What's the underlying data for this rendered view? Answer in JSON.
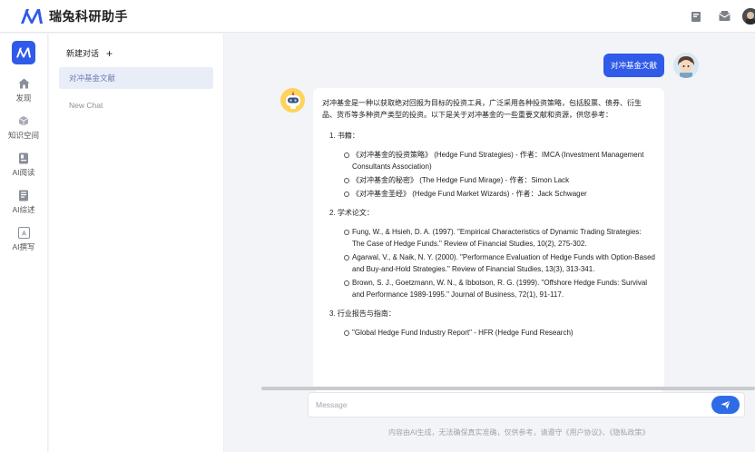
{
  "header": {
    "title": "瑞兔科研助手"
  },
  "nav": {
    "items": [
      {
        "label": "发现",
        "icon": "home-icon"
      },
      {
        "label": "知识空间",
        "icon": "cube-icon"
      },
      {
        "label": "AI阅读",
        "icon": "document-icon"
      },
      {
        "label": "AI综述",
        "icon": "report-icon"
      },
      {
        "label": "AI撰写",
        "icon": "write-icon"
      }
    ]
  },
  "sidebar": {
    "new_chat_label": "新建对话",
    "new_chat_plus": "+",
    "conversations": [
      {
        "label": "对冲基金文献",
        "active": true
      },
      {
        "label": "New Chat",
        "active": false
      }
    ]
  },
  "chat": {
    "user_message": "对冲基金文献",
    "bot": {
      "intro": "对冲基金是一种以获取绝对回报为目标的投资工具，广泛采用各种投资策略，包括股票、债券、衍生品、货币等多种资产类型的投资。以下是关于对冲基金的一些重要文献和资源，供您参考：",
      "sections": [
        {
          "title": "1. 书籍：",
          "items": [
            "《对冲基金的投资策略》 (Hedge Fund Strategies) - 作者：IMCA (Investment Management Consultants Association)",
            "《对冲基金的秘密》 (The Hedge Fund Mirage) - 作者：Simon Lack",
            "《对冲基金圣经》 (Hedge Fund Market Wizards) - 作者：Jack Schwager"
          ]
        },
        {
          "title": "2. 学术论文：",
          "items": [
            "Fung, W., & Hsieh, D. A. (1997). \"Empirical Characteristics of Dynamic Trading Strategies: The Case of Hedge Funds.\" Review of Financial Studies, 10(2), 275-302.",
            "Agarwal, V., & Naik, N. Y. (2000). \"Performance Evaluation of Hedge Funds with Option-Based and Buy-and-Hold Strategies.\" Review of Financial Studies, 13(3), 313-341.",
            "Brown, S. J., Goetzmann, W. N., & Ibbotson, R. G. (1999). \"Offshore Hedge Funds: Survival and Performance 1989-1995.\" Journal of Business, 72(1), 91-117."
          ]
        },
        {
          "title": "3. 行业报告与指南：",
          "items": [
            "\"Global Hedge Fund Industry Report\" - HFR (Hedge Fund Research)"
          ]
        }
      ]
    },
    "input_placeholder": "Message",
    "footer_note": "内容由AI生成，无法确保真实准确，仅供参考，请遵守《用户协议》、《隐私政策》"
  },
  "colors": {
    "accent": "#2f5be8",
    "send_button": "#2f6be6",
    "active_conv_bg": "#e9edf8"
  }
}
